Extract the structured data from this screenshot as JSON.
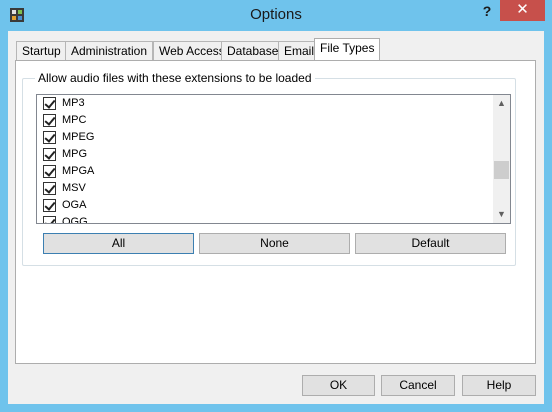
{
  "window": {
    "title": "Options",
    "help_label": "?",
    "close_label": "✕"
  },
  "tabs": [
    {
      "label": "Startup"
    },
    {
      "label": "Administration"
    },
    {
      "label": "Web Access"
    },
    {
      "label": "Database"
    },
    {
      "label": "Email"
    },
    {
      "label": "File Types",
      "active": true
    }
  ],
  "file_types": {
    "group_label": "Allow audio files with these extensions to be loaded",
    "extensions": [
      {
        "label": "MP3",
        "checked": true
      },
      {
        "label": "MPC",
        "checked": true
      },
      {
        "label": "MPEG",
        "checked": true
      },
      {
        "label": "MPG",
        "checked": true
      },
      {
        "label": "MPGA",
        "checked": true
      },
      {
        "label": "MSV",
        "checked": true
      },
      {
        "label": "OGA",
        "checked": true
      },
      {
        "label": "OGG",
        "checked": true
      }
    ],
    "buttons": {
      "all": "All",
      "none": "None",
      "default": "Default"
    }
  },
  "dialog_buttons": {
    "ok": "OK",
    "cancel": "Cancel",
    "help": "Help"
  },
  "colors": {
    "title_bar": "#6fc3ec",
    "close_button": "#c7504b",
    "focus_border": "#3c7fb1"
  }
}
